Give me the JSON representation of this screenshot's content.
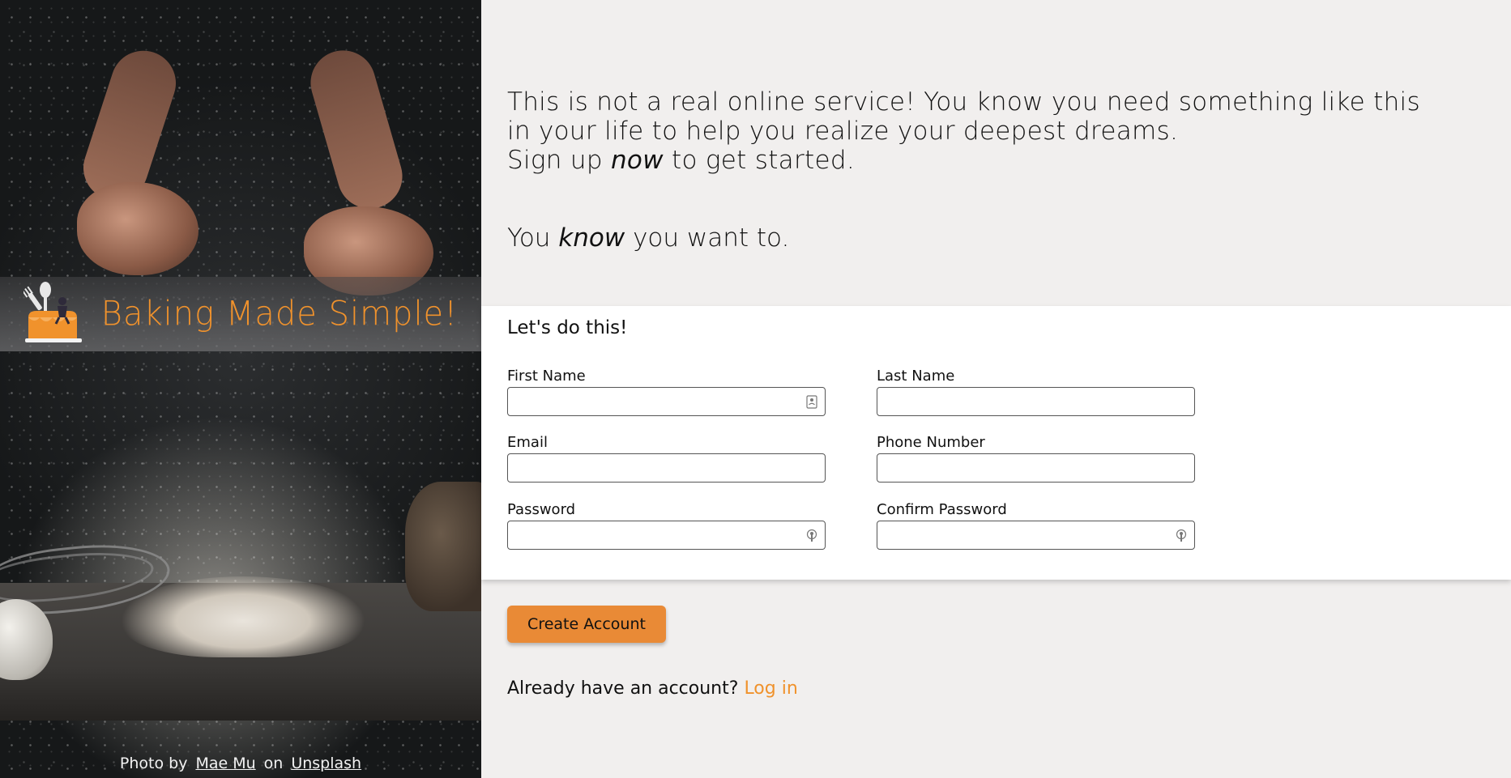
{
  "brand": {
    "title": "Baking Made Simple!",
    "logo_icon": "cake-with-utensils-logo",
    "accent_color": "#f0922c"
  },
  "credit": {
    "prefix": "Photo by",
    "author": "Mae Mu",
    "middle": "on",
    "source": "Unsplash"
  },
  "intro": {
    "line1": "This is not a real online service! You know you need something like this in your life to help you realize your deepest dreams.",
    "line2_start": "Sign up",
    "line2_em": "now",
    "line2_end": "to get started.",
    "line3_start": "You",
    "line3_em": "know",
    "line3_end": "you want to."
  },
  "form": {
    "heading": "Let's do this!",
    "fields": {
      "first_name": {
        "label": "First Name",
        "value": ""
      },
      "last_name": {
        "label": "Last Name",
        "value": ""
      },
      "email": {
        "label": "Email",
        "value": ""
      },
      "phone": {
        "label": "Phone Number",
        "value": ""
      },
      "password": {
        "label": "Password",
        "value": ""
      },
      "confirm_password": {
        "label": "Confirm Password",
        "value": ""
      }
    }
  },
  "actions": {
    "create_label": "Create Account",
    "button_color": "#e98a36",
    "login_prompt": "Already have an account?",
    "login_link": "Log in"
  }
}
